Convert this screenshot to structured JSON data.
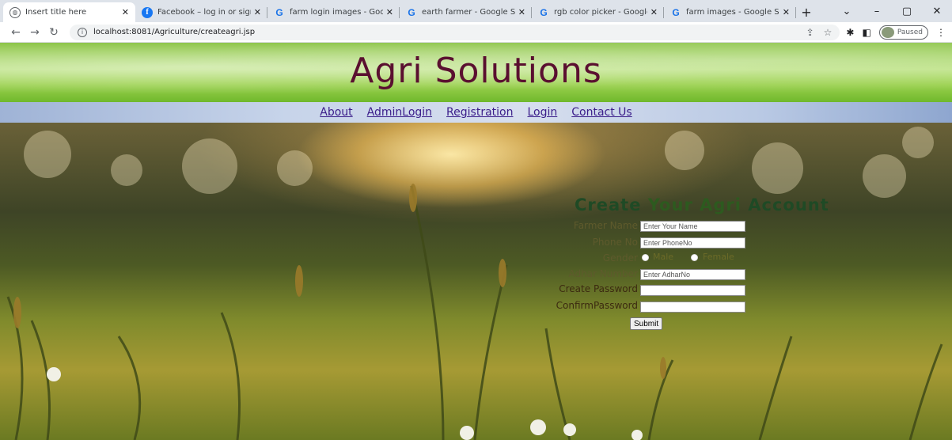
{
  "browser": {
    "tabs": [
      {
        "title": "Insert title here",
        "icon": "globe-icon",
        "active": true
      },
      {
        "title": "Facebook – log in or sign u",
        "icon": "facebook-icon"
      },
      {
        "title": "farm login images - Google",
        "icon": "google-icon"
      },
      {
        "title": "earth farmer - Google Searc",
        "icon": "google-icon"
      },
      {
        "title": "rgb color picker - Google S",
        "icon": "google-icon"
      },
      {
        "title": "farm images - Google Sear",
        "icon": "google-icon"
      }
    ],
    "url": "localhost:8081/Agriculture/createagri.jsp",
    "profile_status": "Paused"
  },
  "site": {
    "brand": "Agri Solutions",
    "nav": [
      "About",
      "AdminLogin",
      "Registration",
      "Login",
      "Contact Us"
    ]
  },
  "form": {
    "title_part1": "Create",
    "title_part2": "Your",
    "title_part3": "Agri",
    "title_part4": "Account",
    "farmer_name_label": "Farmer Name",
    "farmer_name_placeholder": "Enter Your Name",
    "phone_label": "Phone No",
    "phone_placeholder": "Enter PhoneNo",
    "gender_label": "Gender",
    "gender_options": [
      "Male",
      "Female"
    ],
    "adhar_label": "Adhar Number",
    "adhar_placeholder": "Enter AdharNo",
    "create_password_label": "Create Password",
    "confirm_password_label": "ConfirmPassword",
    "submit_label": "Submit"
  },
  "colors": {
    "brand_text": "#5a1030",
    "nav_link": "#3b1d8a",
    "form_title": "#1f4a25"
  }
}
